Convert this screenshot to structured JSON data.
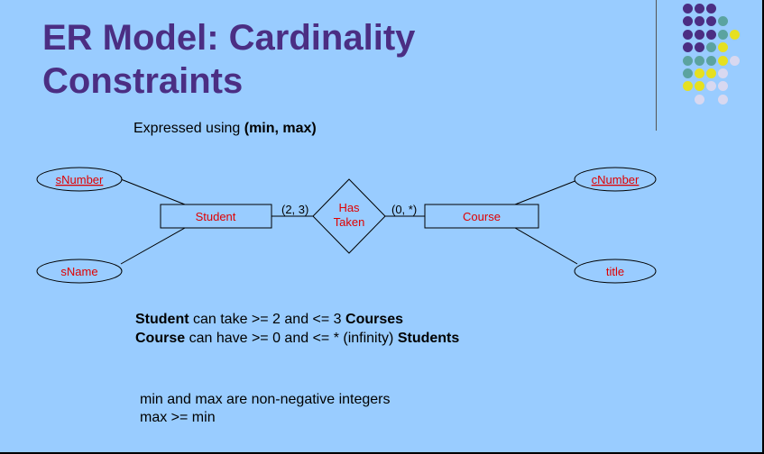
{
  "slide": {
    "title_line1": "ER Model: Cardinality",
    "title_line2": "Constraints",
    "subtitle_prefix": "Expressed using ",
    "subtitle_bold": "(min, max)",
    "decoration_colors": {
      "purple": "#4b2e83",
      "teal": "#5ba3a0",
      "yellow": "#e6e020",
      "lavender": "#d8d8f0"
    }
  },
  "diagram": {
    "entity_student": "Student",
    "entity_course": "Course",
    "relationship_line1": "Has",
    "relationship_line2": "Taken",
    "attr_snumber": "sNumber",
    "attr_sname": "sName",
    "attr_cnumber": "cNumber",
    "attr_title": "title",
    "card_student": "(2, 3)",
    "card_course": "(0, *)"
  },
  "statements": {
    "line1": {
      "b1": "Student",
      "t1": " can take >= 2 and <= 3 ",
      "b2": "Courses"
    },
    "line2": {
      "b1": "Course",
      "t1": " can have >= 0 and <= * (infinity) ",
      "b2": "Students"
    }
  },
  "notes": {
    "line1": "min and max are non-negative integers",
    "line2": "max >= min"
  }
}
